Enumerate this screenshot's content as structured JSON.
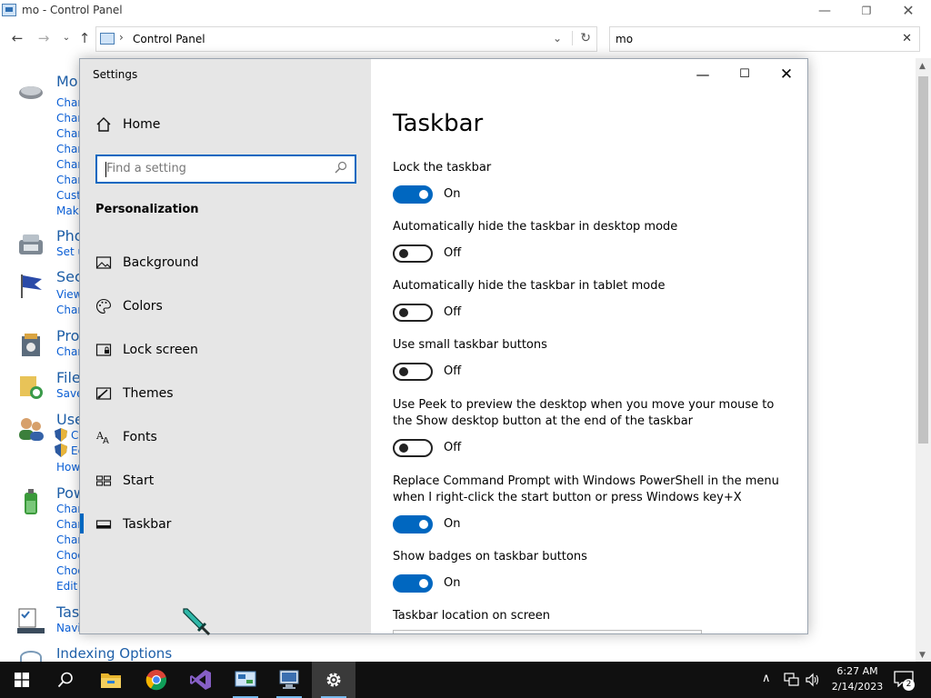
{
  "control_panel": {
    "window_title": "mo - Control Panel",
    "window_buttons": {
      "minimize": "—",
      "maximize": "❐",
      "close": "✕"
    },
    "nav": {
      "back": "←",
      "forward": "→",
      "recent": "⌄",
      "up": "↑"
    },
    "address": {
      "separator": "›",
      "path": "Control Panel",
      "dropdown": "⌄",
      "refresh": "↻"
    },
    "search": {
      "value": "mo",
      "clear": "✕"
    },
    "categories": [
      {
        "title": "Mou",
        "links": [
          "Char",
          "Char",
          "Char",
          "Char",
          "Char",
          "Char",
          "Cust",
          "Make"
        ]
      },
      {
        "title": "Pho",
        "links": [
          "Set u"
        ]
      },
      {
        "title": "Sec",
        "links": [
          "View",
          "Char"
        ]
      },
      {
        "title": "Pro",
        "links": [
          "Char"
        ]
      },
      {
        "title": "File",
        "links": [
          "Save"
        ]
      },
      {
        "title": "Use",
        "links": [
          "Ch",
          "Ec",
          "How"
        ]
      },
      {
        "title": "Pow",
        "links": [
          "Char",
          "Char",
          "Char",
          "Choo",
          "Choo",
          "Edit p"
        ]
      },
      {
        "title": "Task",
        "links": [
          "Navi"
        ]
      }
    ],
    "last_item": "Indexing Options",
    "scroll": {
      "up": "▲",
      "down": "▼"
    }
  },
  "settings": {
    "title": "Settings",
    "window_buttons": {
      "minimize": "—",
      "maximize": "☐",
      "close": "✕"
    },
    "home_label": "Home",
    "search_placeholder": "Find a setting",
    "section_title": "Personalization",
    "nav_items": [
      {
        "label": "Background",
        "icon": "picture-icon"
      },
      {
        "label": "Colors",
        "icon": "palette-icon"
      },
      {
        "label": "Lock screen",
        "icon": "lock-screen-icon"
      },
      {
        "label": "Themes",
        "icon": "themes-icon"
      },
      {
        "label": "Fonts",
        "icon": "fonts-icon"
      },
      {
        "label": "Start",
        "icon": "start-icon"
      },
      {
        "label": "Taskbar",
        "icon": "taskbar-icon"
      }
    ],
    "selected_nav": "Taskbar",
    "page_title": "Taskbar",
    "options": [
      {
        "label": "Lock the taskbar",
        "state": "On"
      },
      {
        "label": "Automatically hide the taskbar in desktop mode",
        "state": "Off"
      },
      {
        "label": "Automatically hide the taskbar in tablet mode",
        "state": "Off"
      },
      {
        "label": "Use small taskbar buttons",
        "state": "Off"
      },
      {
        "label": "Use Peek to preview the desktop when you move your mouse to the Show desktop button at the end of the taskbar",
        "state": "Off"
      },
      {
        "label": "Replace Command Prompt with Windows PowerShell in the menu when I right-click the start button or press Windows key+X",
        "state": "On"
      },
      {
        "label": "Show badges on taskbar buttons",
        "state": "On"
      }
    ],
    "location_label": "Taskbar location on screen",
    "accent_color": "#0067c0"
  },
  "taskbar": {
    "apps": [
      "windows-start-icon",
      "search-icon",
      "file-explorer-icon",
      "chrome-icon",
      "visual-studio-icon",
      "control-panel-icon",
      "remote-desktop-icon",
      "settings-gear-icon"
    ],
    "time": "6:27 AM",
    "date": "2/14/2023",
    "notification_count": "2",
    "tray": {
      "chevron": "∧",
      "network": "🖧",
      "volume": "🔊"
    }
  }
}
